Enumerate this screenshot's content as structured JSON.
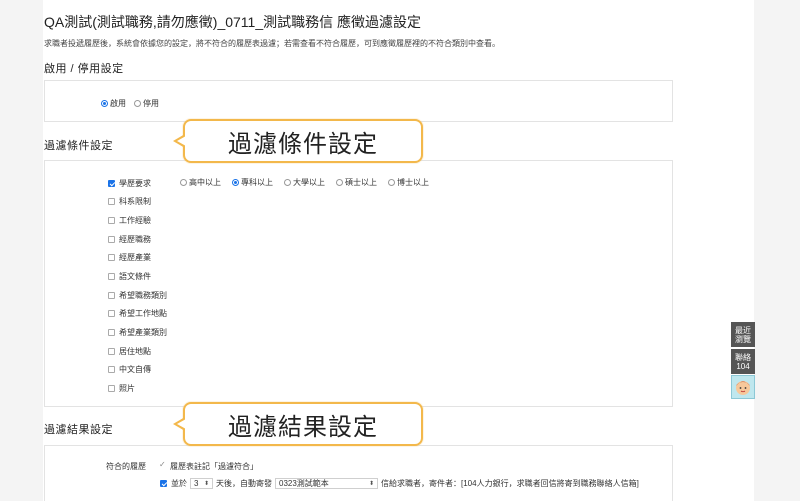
{
  "header": {
    "title": "QA測試(測試職務,請勿應徵)_0711_測試職務信 應徵過濾設定",
    "notice": "求職者投遞履歷後，系統會依據您的設定，將不符合的履歷表過濾；若需查看不符合履歷，可到應徵履歷裡的不符合類別中查看。"
  },
  "enable_section": {
    "title": "啟用 / 停用設定",
    "options": [
      {
        "label": "啟用",
        "selected": true
      },
      {
        "label": "停用",
        "selected": false
      }
    ]
  },
  "filter_section": {
    "title": "過濾條件設定",
    "callout": "過濾條件設定",
    "criteria": [
      {
        "label": "學歷要求",
        "checked": true
      },
      {
        "label": "科系限制",
        "checked": false
      },
      {
        "label": "工作經驗",
        "checked": false
      },
      {
        "label": "經歷職務",
        "checked": false
      },
      {
        "label": "經歷產業",
        "checked": false
      },
      {
        "label": "語文條件",
        "checked": false
      },
      {
        "label": "希望職務類別",
        "checked": false
      },
      {
        "label": "希望工作地點",
        "checked": false
      },
      {
        "label": "希望產業類別",
        "checked": false
      },
      {
        "label": "居住地點",
        "checked": false
      },
      {
        "label": "中文自傳",
        "checked": false
      },
      {
        "label": "照片",
        "checked": false
      }
    ],
    "education_options": [
      {
        "label": "高中以上",
        "selected": false
      },
      {
        "label": "專科以上",
        "selected": true
      },
      {
        "label": "大學以上",
        "selected": false
      },
      {
        "label": "碩士以上",
        "selected": false
      },
      {
        "label": "博士以上",
        "selected": false
      }
    ]
  },
  "result_section": {
    "title": "過濾結果設定",
    "callout": "過濾結果設定",
    "match_label": "符合的履歷",
    "mark_label": "履歷表註記「過濾符合」",
    "and_label": "並於",
    "days_value": "3",
    "after_days_text": "天後，自動寄發",
    "template_value": "0323測試範本",
    "send_text": "信給求職者，寄件者：[104人力銀行，求職者回信將寄到職務聯絡人信箱]"
  },
  "side_widget": {
    "recent_label": "最近\n瀏覽",
    "contact_label": "聯絡\n104"
  },
  "colors": {
    "accent": "#1a73e8",
    "callout_border": "#f3b84b",
    "widget_bg": "#555555"
  }
}
